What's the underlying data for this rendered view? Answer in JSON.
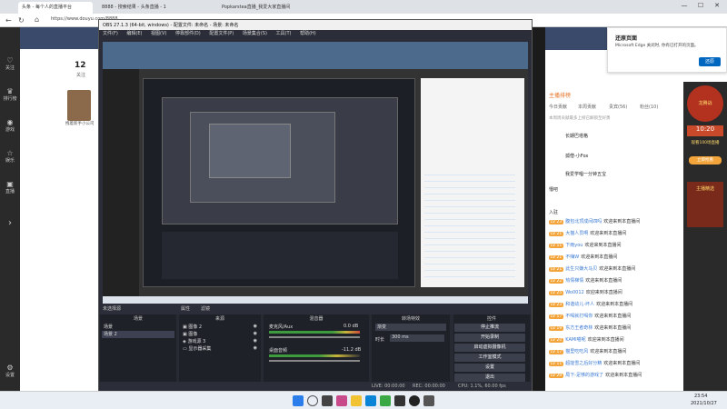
{
  "browser": {
    "tabs": [
      "头条 - 每个人的直播平台",
      "8888 - 搜索结果 - 头条直播 - 1",
      "Popkarstea直播_我爱大家直播间"
    ],
    "url": "https://www.douyu.com/8888",
    "window_controls": [
      "—",
      "☐",
      "✕"
    ]
  },
  "site_left": {
    "items": [
      "关注",
      "排行榜",
      "游戏",
      "娱乐",
      "直播",
      "设置"
    ]
  },
  "obs": {
    "title": "OBS 27.1.3 (64-bit, windows) - 配置文件: 未命名 - 场景: 未命名",
    "menu": [
      "文件(F)",
      "编辑(E)",
      "视图(V)",
      "停靠部件(D)",
      "配置文件(P)",
      "场景集合(S)",
      "工具(T)",
      "帮助(H)"
    ],
    "source_none": "未选择源",
    "props_btn": "属性",
    "filter_btn": "滤镜",
    "panels": {
      "scenes": {
        "title": "场景",
        "items": [
          "场景",
          "场景 2"
        ]
      },
      "sources": {
        "title": "来源",
        "items": [
          "图像 2",
          "图像",
          "游戏源 3",
          "显示器采集"
        ]
      },
      "mixer": {
        "title": "混音器",
        "ch1": "麦克风/Aux",
        "ch1_db": "0.0 dB",
        "ch2": "桌面音频",
        "ch2_db": "-11.2 dB"
      },
      "transitions": {
        "title": "转场特效",
        "type": "渐变",
        "duration_label": "时长",
        "duration": "300 ms"
      },
      "controls": {
        "title": "控件",
        "buttons": [
          "停止推流",
          "开始录制",
          "启动虚拟摄像机",
          "工作室模式",
          "设置",
          "退出"
        ]
      }
    },
    "status": {
      "live": "LIVE: 00:00:00",
      "rec": "REC: 00:00:00",
      "cpu": "CPU: 1.1%, 60.00 fps"
    }
  },
  "room": {
    "follows": "12",
    "follows_label": "关注",
    "streamer_label": "拽着新手小公司"
  },
  "popup": {
    "title": "还原页面",
    "body": "Microsoft Edge 关闭时, 你有已打开的页面。",
    "button": "还原"
  },
  "rank": {
    "header": "主播排榜",
    "tabs": [
      "今日贡献",
      "本周贡献",
      "贵宾(56)",
      "粉丝(10)"
    ],
    "sub": "本周周贡献最多上榜已解锁至好勇",
    "users": [
      "长期巴塔格",
      "孤僧-小Fox",
      "我爱学唱一分钟五宝"
    ]
  },
  "chat": {
    "notice": "懵吧",
    "entry": "入驻",
    "rows": [
      {
        "lv": "LV 23",
        "name": "腹包北顶成间四吗",
        "msg": "欢迎来到本直播间"
      },
      {
        "lv": "LV 21",
        "name": "大猫人员啊",
        "msg": "欢迎来到本直播间"
      },
      {
        "lv": "LV 11",
        "name": "下雨you",
        "msg": "欢迎来到本直播间"
      },
      {
        "lv": "LV 21",
        "name": "不嗨W",
        "msg": "欢迎来到本直播间"
      },
      {
        "lv": "LV 21",
        "name": "此生只嫌大马贝",
        "msg": "欢迎来到本直播间"
      },
      {
        "lv": "LV 22",
        "name": "热情梯情",
        "msg": "欢迎来到本直播间"
      },
      {
        "lv": "LV 25",
        "name": "Wo0012",
        "msg": "欢迎来到本直播间"
      },
      {
        "lv": "LV 23",
        "name": "和谐幼儿-坏人",
        "msg": "欢迎来到本直播间"
      },
      {
        "lv": "LV 17",
        "name": "不喝就打喝你",
        "msg": "欢迎来到本直播间"
      },
      {
        "lv": "LV 19",
        "name": "东方王者奇林",
        "msg": "欢迎来到本直播间"
      },
      {
        "lv": "LV 20",
        "name": "KAMI喵呢",
        "msg": "欢迎来到本直播间"
      },
      {
        "lv": "LV 17",
        "name": "猫里吃吃风",
        "msg": "欢迎来到本直播间"
      },
      {
        "lv": "LV 11",
        "name": "超能雪之后好分精",
        "msg": "欢迎来到本直播间"
      },
      {
        "lv": "LV 29",
        "name": "局下-足够的游戏了",
        "msg": "欢迎来到本直播间"
      }
    ]
  },
  "ads": {
    "badge1": "龙腾战",
    "time": "10:20",
    "sub": "观看100场直播",
    "btn": "立即抢看",
    "badge2": "主播精选"
  },
  "taskbar": {
    "time": "23:54",
    "date": "2021/10/27"
  },
  "colors": {
    "accent": "#f3a53b",
    "obs_bg": "#2b2e38",
    "live_red": "#ff6b4a"
  }
}
